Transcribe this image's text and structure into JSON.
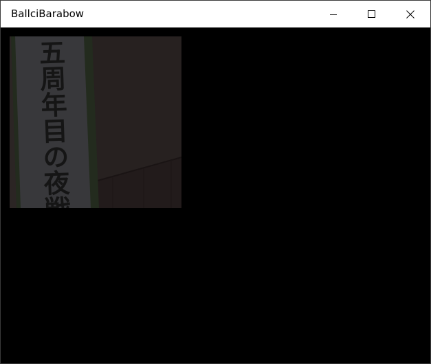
{
  "window": {
    "title": "BallciBarabow"
  },
  "controls": {
    "minimize_icon": "minimize-icon",
    "maximize_icon": "maximize-icon",
    "close_icon": "close-icon"
  },
  "photo": {
    "banner_text": "五周年目の夜戦帝"
  },
  "colors": {
    "titlebar_bg": "#ffffff",
    "content_bg": "#000000",
    "wall": "#2a2423",
    "banner_paper": "#3a3a3d",
    "banner_border": "#243020"
  }
}
